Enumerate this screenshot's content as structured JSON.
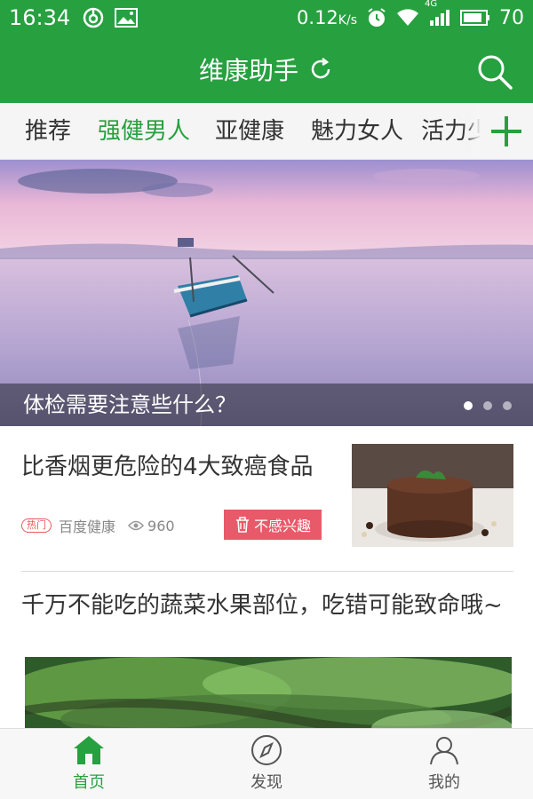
{
  "status_bar": {
    "time": "16:34",
    "net_speed": "0.12",
    "net_speed_unit": "K/s",
    "network_type": "4G",
    "battery": "70"
  },
  "app": {
    "title": "维康助手"
  },
  "tabs": [
    {
      "label": "推荐",
      "active": false
    },
    {
      "label": "强健男人",
      "active": true
    },
    {
      "label": "亚健康",
      "active": false
    },
    {
      "label": "魅力女人",
      "active": false
    },
    {
      "label": "活力少",
      "active": false
    }
  ],
  "banner": {
    "caption": "体检需要注意些什么？",
    "slide_count": 3,
    "current_slide": 1
  },
  "feed": {
    "items": [
      {
        "title": "比香烟更危险的4大致癌食品",
        "tag": "热门",
        "source": "百度健康",
        "views": "960",
        "dislike_label": "不感兴趣"
      },
      {
        "title": "千万不能吃的蔬菜水果部位，吃错可能致命哦~"
      }
    ]
  },
  "bottom_nav": [
    {
      "label": "首页",
      "active": true
    },
    {
      "label": "发现",
      "active": false
    },
    {
      "label": "我的",
      "active": false
    }
  ],
  "colors": {
    "brand_green": "#27a040",
    "dislike_red": "#e85a6a"
  }
}
